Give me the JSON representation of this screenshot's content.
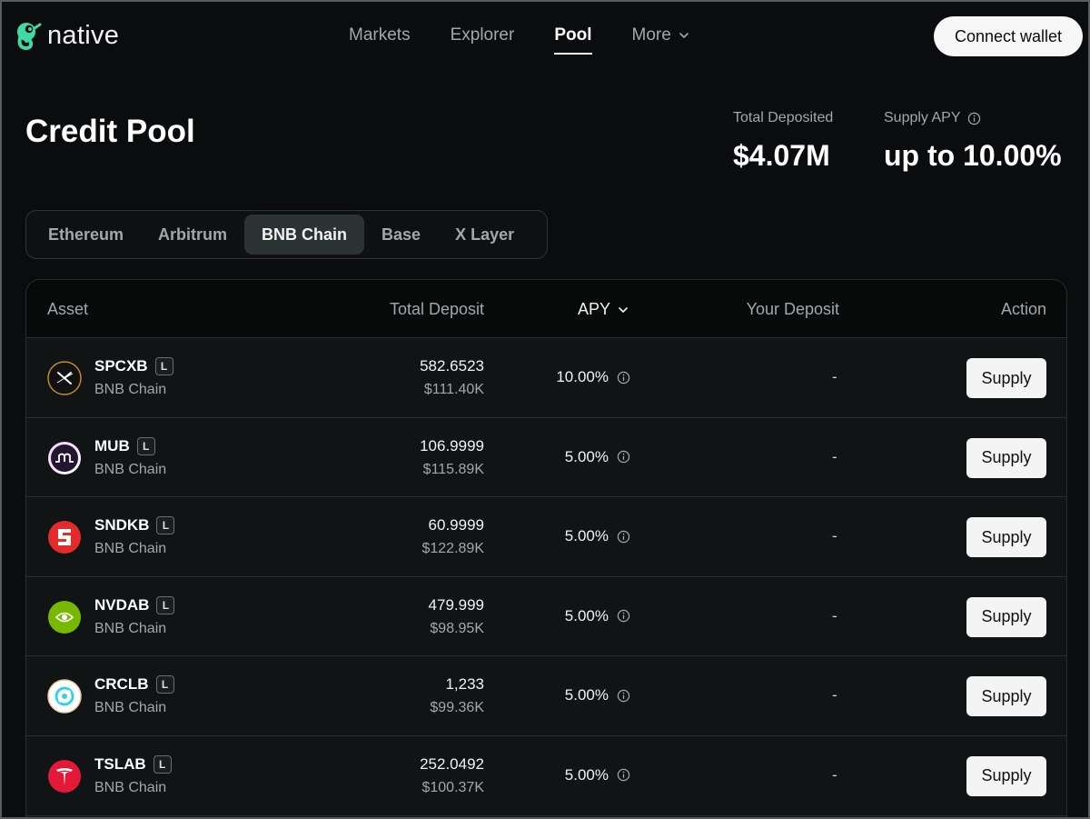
{
  "brand": {
    "name": "native"
  },
  "nav": {
    "links": [
      {
        "label": "Markets"
      },
      {
        "label": "Explorer"
      },
      {
        "label": "Pool"
      },
      {
        "label": "More"
      }
    ],
    "active": "Pool",
    "connect_label": "Connect wallet"
  },
  "page": {
    "title": "Credit Pool",
    "total_deposited_label": "Total Deposited",
    "total_deposited_value": "$4.07M",
    "supply_apy_label": "Supply APY",
    "supply_apy_value": "up to 10.00%"
  },
  "tabs": [
    {
      "label": "Ethereum"
    },
    {
      "label": "Arbitrum"
    },
    {
      "label": "BNB Chain"
    },
    {
      "label": "Base"
    },
    {
      "label": "X Layer"
    }
  ],
  "active_tab": "BNB Chain",
  "table": {
    "headers": {
      "asset": "Asset",
      "total_deposit": "Total Deposit",
      "apy": "APY",
      "your_deposit": "Your Deposit",
      "action": "Action"
    },
    "rows": [
      {
        "symbol": "SPCXB",
        "badge": "L",
        "chain": "BNB Chain",
        "amount": "582.6523",
        "usd": "$111.40K",
        "apy": "10.00%",
        "your_deposit": "-",
        "action": "Supply",
        "icon": "spacex-icon",
        "icon_bg": "#111111"
      },
      {
        "symbol": "MUB",
        "badge": "L",
        "chain": "BNB Chain",
        "amount": "106.9999",
        "usd": "$115.89K",
        "apy": "5.00%",
        "your_deposit": "-",
        "action": "Supply",
        "icon": "mub-icon",
        "icon_bg": "#2a1b3a"
      },
      {
        "symbol": "SNDKB",
        "badge": "L",
        "chain": "BNB Chain",
        "amount": "60.9999",
        "usd": "$122.89K",
        "apy": "5.00%",
        "your_deposit": "-",
        "action": "Supply",
        "icon": "sandisk-icon",
        "icon_bg": "#e32b2b"
      },
      {
        "symbol": "NVDAB",
        "badge": "L",
        "chain": "BNB Chain",
        "amount": "479.999",
        "usd": "$98.95K",
        "apy": "5.00%",
        "your_deposit": "-",
        "action": "Supply",
        "icon": "nvidia-icon",
        "icon_bg": "#76b900"
      },
      {
        "symbol": "CRCLB",
        "badge": "L",
        "chain": "BNB Chain",
        "amount": "1,233",
        "usd": "$99.36K",
        "apy": "5.00%",
        "your_deposit": "-",
        "action": "Supply",
        "icon": "circle-icon",
        "icon_bg": "#ffffff"
      },
      {
        "symbol": "TSLAB",
        "badge": "L",
        "chain": "BNB Chain",
        "amount": "252.0492",
        "usd": "$100.37K",
        "apy": "5.00%",
        "your_deposit": "-",
        "action": "Supply",
        "icon": "tesla-icon",
        "icon_bg": "#e31937"
      }
    ]
  }
}
